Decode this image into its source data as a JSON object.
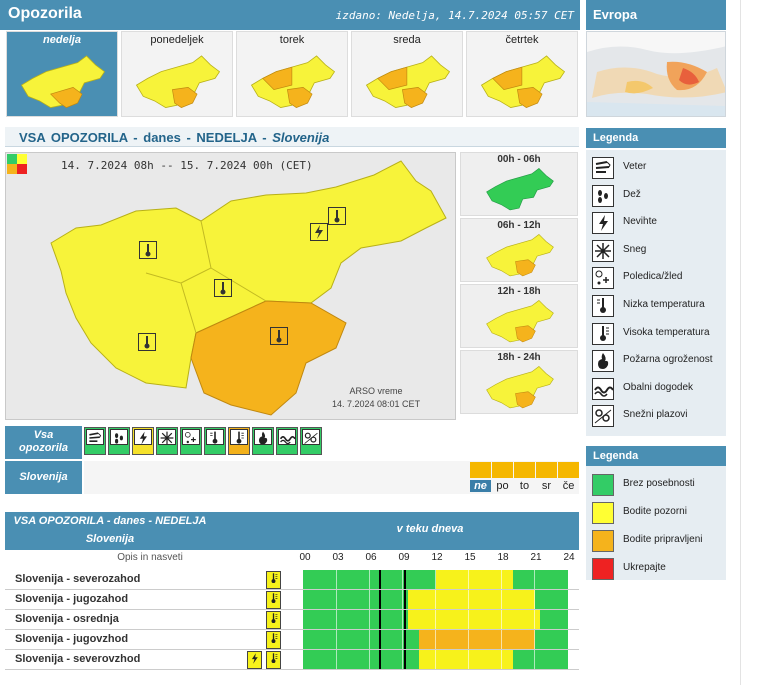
{
  "header": {
    "title": "Opozorila",
    "issued": "izdano: Nedelja, 14.7.2024 05:57 CET"
  },
  "europe": {
    "title": "Evropa"
  },
  "days": [
    {
      "label": "nedelja",
      "active": true
    },
    {
      "label": "ponedeljek",
      "active": false
    },
    {
      "label": "torek",
      "active": false
    },
    {
      "label": "sreda",
      "active": false
    },
    {
      "label": "četrtek",
      "active": false
    }
  ],
  "section": {
    "title_a": "VSA OPOZORILA",
    "dash1": "-",
    "title_b": "danes",
    "dash2": "-",
    "title_c": "NEDELJA",
    "dash3": "-",
    "title_d": "Slovenija"
  },
  "map": {
    "period": "14. 7.2024  08h  --  15. 7.2024  00h     (CET)",
    "source": "ARSO vreme",
    "timestamp": "14. 7.2024  08:01 CET"
  },
  "periods": [
    {
      "label": "00h - 06h",
      "level": "green"
    },
    {
      "label": "06h - 12h",
      "level": "yellow"
    },
    {
      "label": "12h - 18h",
      "level": "yellow"
    },
    {
      "label": "18h - 24h",
      "level": "yellow"
    }
  ],
  "legend_types": {
    "title": "Legenda",
    "items": [
      {
        "label": "Veter",
        "icon": "wind-icon"
      },
      {
        "label": "Dež",
        "icon": "rain-icon"
      },
      {
        "label": "Nevihte",
        "icon": "thunderstorm-icon"
      },
      {
        "label": "Sneg",
        "icon": "snow-icon"
      },
      {
        "label": "Poledica/žled",
        "icon": "ice-icon"
      },
      {
        "label": "Nizka temperatura",
        "icon": "low-temperature-icon"
      },
      {
        "label": "Visoka temperatura",
        "icon": "high-temperature-icon"
      },
      {
        "label": "Požarna ogroženost",
        "icon": "fire-icon"
      },
      {
        "label": "Obalni dogodek",
        "icon": "coastal-icon"
      },
      {
        "label": "Snežni plazovi",
        "icon": "avalanche-icon"
      }
    ]
  },
  "legend_colors": {
    "title": "Legenda",
    "items": [
      {
        "label": "Brez posebnosti",
        "color": "#33cc66"
      },
      {
        "label": "Bodite pozorni",
        "color": "#ffff33"
      },
      {
        "label": "Bodite pripravljeni",
        "color": "#f5b31c"
      },
      {
        "label": "Ukrepajte",
        "color": "#ee2222"
      }
    ]
  },
  "strip": {
    "row1_label_a": "Vsa",
    "row1_label_b": "opozorila",
    "row2_label": "Slovenija",
    "forecast_days": [
      "ne",
      "po",
      "to",
      "sr",
      "če"
    ]
  },
  "table": {
    "title": "VSA OPOZORILA - danes - NEDELJA",
    "region": "Slovenija",
    "timeline_title": "v teku dneva",
    "desc_header": "Opis in nasveti",
    "hours": [
      "00",
      "03",
      "06",
      "09",
      "12",
      "15",
      "18",
      "21",
      "24"
    ],
    "rows": [
      {
        "name": "Slovenija - severozahod",
        "icons": [
          "high-temperature-icon"
        ],
        "segments": [
          [
            "g",
            12
          ],
          [
            "yy",
            7
          ],
          [
            "g",
            5
          ]
        ]
      },
      {
        "name": "Slovenija - jugozahod",
        "icons": [
          "high-temperature-icon"
        ],
        "segments": [
          [
            "g",
            9.5
          ],
          [
            "yy",
            11.5
          ],
          [
            "g",
            3
          ]
        ]
      },
      {
        "name": "Slovenija - osrednja",
        "icons": [
          "high-temperature-icon"
        ],
        "segments": [
          [
            "g",
            9.5
          ],
          [
            "yy",
            12
          ],
          [
            "g",
            2.5
          ]
        ]
      },
      {
        "name": "Slovenija - jugovzhod",
        "icons": [
          "high-temperature-icon"
        ],
        "segments": [
          [
            "g",
            10.5
          ],
          [
            "oo",
            10.5
          ],
          [
            "g",
            3
          ]
        ]
      },
      {
        "name": "Slovenija - severovzhod",
        "icons": [
          "thunderstorm-icon",
          "high-temperature-icon"
        ],
        "segments": [
          [
            "g",
            10.5
          ],
          [
            "yy",
            8.5
          ],
          [
            "g",
            5
          ]
        ]
      }
    ]
  }
}
